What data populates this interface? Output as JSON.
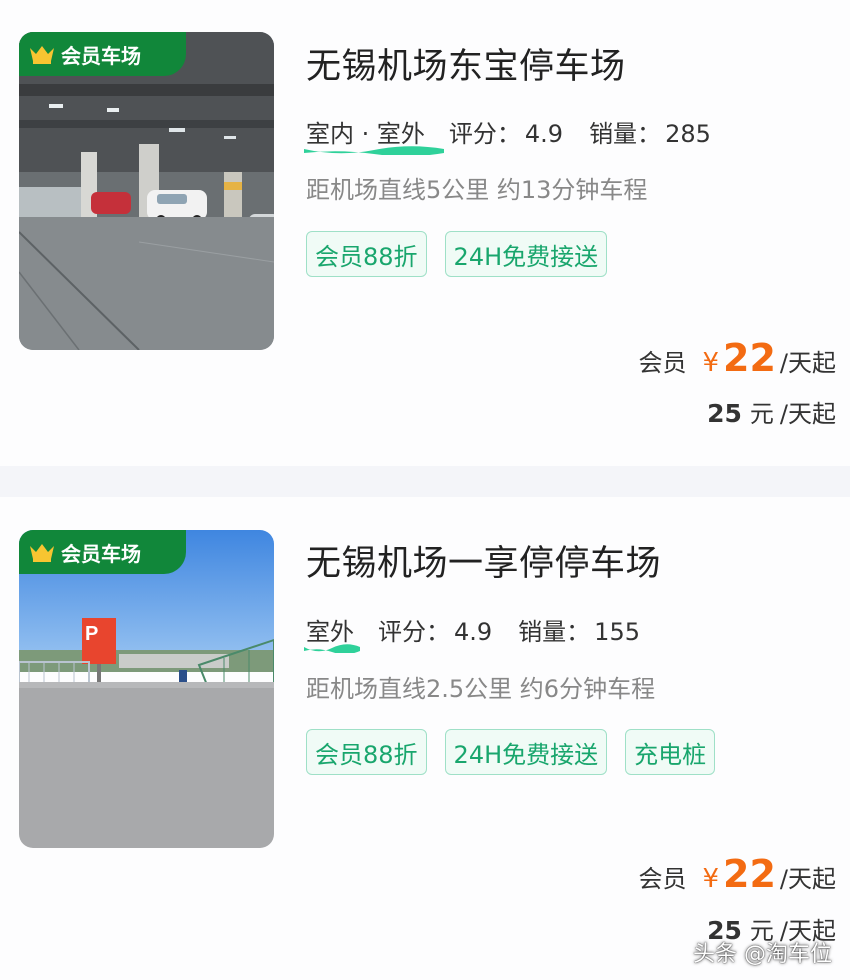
{
  "listings": [
    {
      "badge": "会员车场",
      "title": "无锡机场东宝停车场",
      "env": "室内 · 室外",
      "rating_label": "评分：",
      "rating": "4.9",
      "sales_label": "销量：",
      "sales": "285",
      "distance": "距机场直线5公里 约13分钟车程",
      "tags": [
        "会员88折",
        "24H免费接送"
      ],
      "member_label": "会员",
      "currency": "¥",
      "member_price": "22",
      "per_day": "/天起",
      "normal_price": "25",
      "normal_currency": "元",
      "photo": "indoor-garage-photo"
    },
    {
      "badge": "会员车场",
      "title": "无锡机场一享停停车场",
      "env": "室外",
      "rating_label": "评分：",
      "rating": "4.9",
      "sales_label": "销量：",
      "sales": "155",
      "distance": "距机场直线2.5公里 约6分钟车程",
      "tags": [
        "会员88折",
        "24H免费接送",
        "充电桩"
      ],
      "member_label": "会员",
      "currency": "¥",
      "member_price": "22",
      "per_day": "/天起",
      "normal_price": "25",
      "normal_currency": "元",
      "photo": "outdoor-lot-photo"
    }
  ],
  "watermark": "头条 @淘车位",
  "colors": {
    "badge_green": "#11873a",
    "tag_green": "#19a66d",
    "price_orange": "#f36b12",
    "wave_green": "#2fd19a"
  }
}
